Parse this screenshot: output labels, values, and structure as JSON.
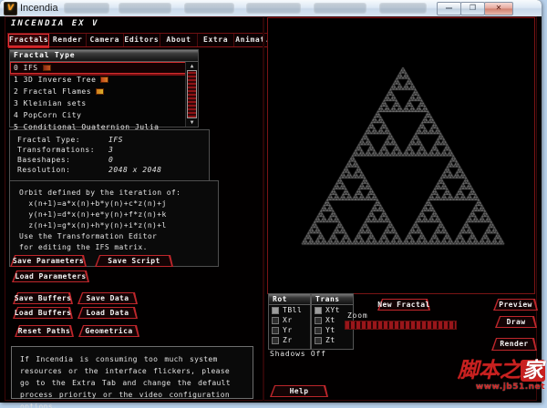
{
  "titlebar": {
    "title": "Incendia",
    "logo_glyph": "V",
    "controls": {
      "minimize": "—",
      "maximize": "❐",
      "close": "✕"
    }
  },
  "app_header": {
    "label": "INCENDIA EX V"
  },
  "menu": {
    "tabs": [
      {
        "label": "Fractals",
        "active": true
      },
      {
        "label": "Render"
      },
      {
        "label": "Camera"
      },
      {
        "label": "Editors"
      },
      {
        "label": "About"
      },
      {
        "label": "Extra"
      },
      {
        "label": "Animat."
      }
    ]
  },
  "fractal_list": {
    "header": "Fractal Type",
    "items": [
      {
        "label": "0 IFS",
        "selected": true,
        "icon": "thumbnail"
      },
      {
        "label": "1 3D Inverse Tree",
        "icon": "thumbnail"
      },
      {
        "label": "2 Fractal Flames",
        "icon": "thumbnail"
      },
      {
        "label": "3 Kleinian sets"
      },
      {
        "label": "4 PopCorn City"
      },
      {
        "label": "5 Conditional Quaternion Julia"
      }
    ]
  },
  "info_panel": {
    "rows": [
      {
        "label": "Fractal Type:",
        "value": "IFS"
      },
      {
        "label": "Transformations:",
        "value": "3"
      },
      {
        "label": "Baseshapes:",
        "value": "0"
      },
      {
        "label": "Resolution:",
        "value": "2048 x 2048"
      }
    ]
  },
  "orbit_panel": {
    "lines": [
      "Orbit defined by the iteration of:",
      "  x(n+1)=a*x(n)+b*y(n)+c*z(n)+j",
      "  y(n+1)=d*x(n)+e*y(n)+f*z(n)+k",
      "  z(n+1)=g*x(n)+h*y(n)+i*z(n)+l",
      "Use the Transformation Editor",
      "for editing the IFS matrix."
    ]
  },
  "buttons": {
    "save_parameters": "Save Parameters",
    "save_script": "Save Script",
    "load_parameters": "Load Parameters",
    "save_buffers": "Save Buffers",
    "save_data": "Save Data",
    "load_buffers": "Load Buffers",
    "load_data": "Load Data",
    "reset_paths": "Reset Paths",
    "geometrica": "Geometrica",
    "new_fractal": "New Fractal",
    "preview": "Preview",
    "draw": "Draw",
    "render": "Render",
    "help": "Help"
  },
  "notice": {
    "text": "If Incendia is consuming too much system resources or the interface flickers, please go to the Extra Tab and change the default process priority or the video configuration options."
  },
  "controls": {
    "rot": {
      "header": "Rot",
      "items": [
        {
          "label": "TBll",
          "checked": true
        },
        {
          "label": "Xr"
        },
        {
          "label": "Yr"
        },
        {
          "label": "Zr"
        }
      ]
    },
    "trans": {
      "header": "Trans",
      "items": [
        {
          "label": "XYt",
          "checked": true
        },
        {
          "label": "Xt"
        },
        {
          "label": "Yt"
        },
        {
          "label": "Zt"
        }
      ]
    },
    "shadows_label": "Shadows Off",
    "zoom_label": "Zoom"
  },
  "viewport": {
    "content": "sierpinski-triangle-ifs-render",
    "point_color": "#b4b4b4",
    "background": "#000000"
  },
  "watermark": {
    "chars_red": "脚本之",
    "char_boxed": "家",
    "url": "www.jb51.net"
  },
  "theme": {
    "accent_red": "#bd262b",
    "border_dark_red": "#7a1415",
    "panel_border_gray": "#4f4f4f",
    "text": "#e8e8e8",
    "desktop_blue": "#b9d2ec"
  }
}
